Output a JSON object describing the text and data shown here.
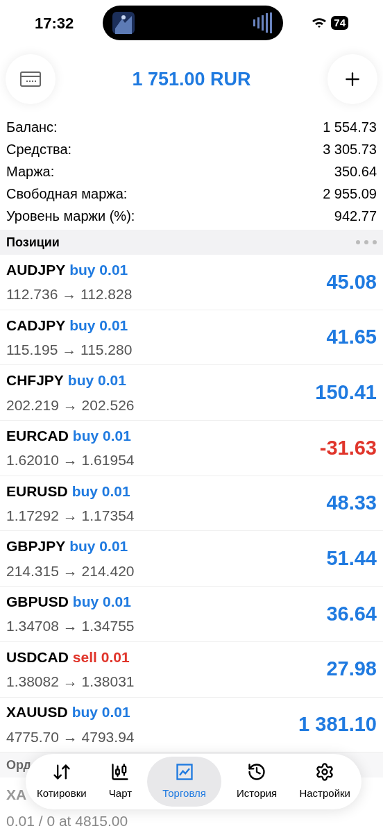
{
  "status_bar": {
    "time": "17:32",
    "battery": "74"
  },
  "header": {
    "title": "1 751.00 RUR"
  },
  "summary": [
    {
      "label": "Баланс:",
      "value": "1 554.73"
    },
    {
      "label": "Средства:",
      "value": "3 305.73"
    },
    {
      "label": "Маржа:",
      "value": "350.64"
    },
    {
      "label": "Свободная маржа:",
      "value": "2 955.09"
    },
    {
      "label": "Уровень маржи (%):",
      "value": "942.77"
    }
  ],
  "positions": {
    "title": "Позиции",
    "rows": [
      {
        "symbol": "AUDJPY",
        "kind": "buy",
        "volume": "buy 0.01",
        "prices": "112.736 → 112.828",
        "profit": "45.08",
        "loss": false
      },
      {
        "symbol": "CADJPY",
        "kind": "buy",
        "volume": "buy 0.01",
        "prices": "115.195 → 115.280",
        "profit": "41.65",
        "loss": false
      },
      {
        "symbol": "CHFJPY",
        "kind": "buy",
        "volume": "buy 0.01",
        "prices": "202.219 → 202.526",
        "profit": "150.41",
        "loss": false
      },
      {
        "symbol": "EURCAD",
        "kind": "buy",
        "volume": "buy 0.01",
        "prices": "1.62010 → 1.61954",
        "profit": "-31.63",
        "loss": true
      },
      {
        "symbol": "EURUSD",
        "kind": "buy",
        "volume": "buy 0.01",
        "prices": "1.17292 → 1.17354",
        "profit": "48.33",
        "loss": false
      },
      {
        "symbol": "GBPJPY",
        "kind": "buy",
        "volume": "buy 0.01",
        "prices": "214.315 → 214.420",
        "profit": "51.44",
        "loss": false
      },
      {
        "symbol": "GBPUSD",
        "kind": "buy",
        "volume": "buy 0.01",
        "prices": "1.34708 → 1.34755",
        "profit": "36.64",
        "loss": false
      },
      {
        "symbol": "USDCAD",
        "kind": "sell",
        "volume": "sell 0.01",
        "prices": "1.38082 → 1.38031",
        "profit": "27.98",
        "loss": false
      },
      {
        "symbol": "XAUUSD",
        "kind": "buy",
        "volume": "buy 0.01",
        "prices": "4775.70 → 4793.94",
        "profit": "1 381.10",
        "loss": false
      }
    ]
  },
  "orders": {
    "title": "Орд",
    "rows": [
      {
        "symbol": "XA",
        "details": "0.01 / 0 at 4815.00"
      }
    ]
  },
  "tab_bar": [
    {
      "label": "Котировки",
      "selected": false
    },
    {
      "label": "Чарт",
      "selected": false
    },
    {
      "label": "Торговля",
      "selected": true
    },
    {
      "label": "История",
      "selected": false
    },
    {
      "label": "Настройки",
      "selected": false
    }
  ]
}
